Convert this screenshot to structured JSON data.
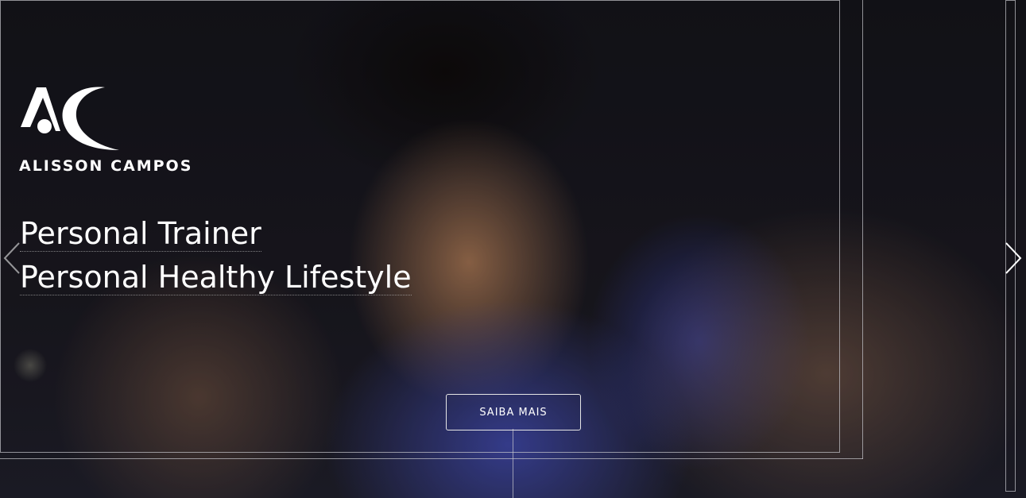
{
  "brand": {
    "logo_text": "ALISSON CAMPOS"
  },
  "hero": {
    "headline_1": "Personal Trainer",
    "headline_2": "Personal Healthy Lifestyle",
    "cta_label": "SAIBA MAIS"
  },
  "icons": {
    "prev": "chevron-left-icon",
    "next": "chevron-right-icon",
    "logo": "ac-logo-icon"
  },
  "colors": {
    "text": "#ffffff",
    "shirt_blue": "#3d46c2",
    "background": "#15151c"
  }
}
